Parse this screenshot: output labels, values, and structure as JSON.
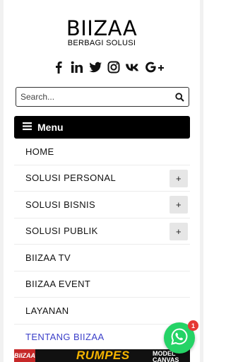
{
  "brand": {
    "title": "BIIZAA",
    "subtitle": "BERBAGI SOLUSI"
  },
  "social": [
    "facebook-icon",
    "linkedin-icon",
    "twitter-icon",
    "instagram-icon",
    "vk-icon",
    "google-plus-icon"
  ],
  "search": {
    "placeholder": "Search..."
  },
  "menu": {
    "label": "Menu",
    "items": [
      {
        "label": "HOME",
        "expandable": false
      },
      {
        "label": "SOLUSI PERSONAL",
        "expandable": true
      },
      {
        "label": "SOLUSI BISNIS",
        "expandable": true
      },
      {
        "label": "SOLUSI PUBLIK",
        "expandable": true
      },
      {
        "label": "BIIZAA TV",
        "expandable": false
      },
      {
        "label": "BIIZAA EVENT",
        "expandable": false
      },
      {
        "label": "LAYANAN",
        "expandable": false
      },
      {
        "label": "TENTANG BIIZAA",
        "expandable": false,
        "active": true
      }
    ],
    "expand_symbol": "+"
  },
  "banner": {
    "left": "BIIZAA",
    "main": "RUMPES",
    "right_line1": "MODEL",
    "right_line2": "CANVAS"
  },
  "whatsapp": {
    "badge": "1"
  },
  "colors": {
    "menu_bar": "#000000",
    "active_link": "#3a3ec8",
    "whatsapp": "#25d366",
    "badge": "#e53935"
  }
}
